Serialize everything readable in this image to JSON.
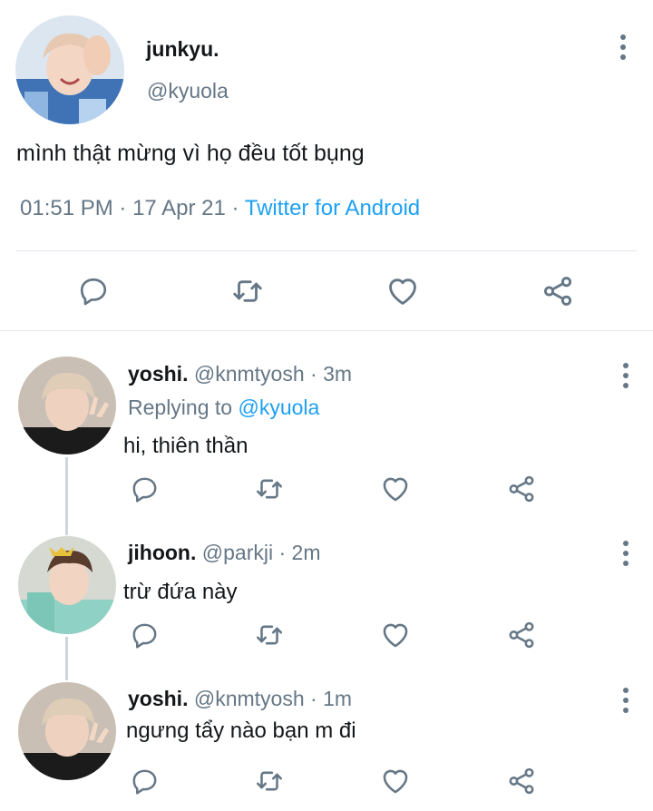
{
  "main_tweet": {
    "name": "junkyu.",
    "handle": "@kyuola",
    "text": "mình thật mừng vì họ đều tốt bụng",
    "time": "01:51 PM",
    "date": "17 Apr 21",
    "source": "Twitter for Android",
    "separator": "·"
  },
  "replies": [
    {
      "name": "yoshi.",
      "handle": "@knmtyosh",
      "time": "3m",
      "replying_prefix": "Replying to",
      "replying_to": "@kyuola",
      "text": "hi, thiên thần"
    },
    {
      "name": "jihoon.",
      "handle": "@parkji",
      "time": "2m",
      "text": "trừ đứa này"
    },
    {
      "name": "yoshi.",
      "handle": "@knmtyosh",
      "time": "1m",
      "text": "ngưng tẩy nào bạn m đi"
    }
  ],
  "icons": [
    "reply-icon",
    "retweet-icon",
    "like-icon",
    "share-icon",
    "more-options-icon"
  ],
  "colors": {
    "accent": "#1da1f2",
    "muted": "#657786",
    "divider": "#e1e8ed",
    "icon": "#657786"
  }
}
